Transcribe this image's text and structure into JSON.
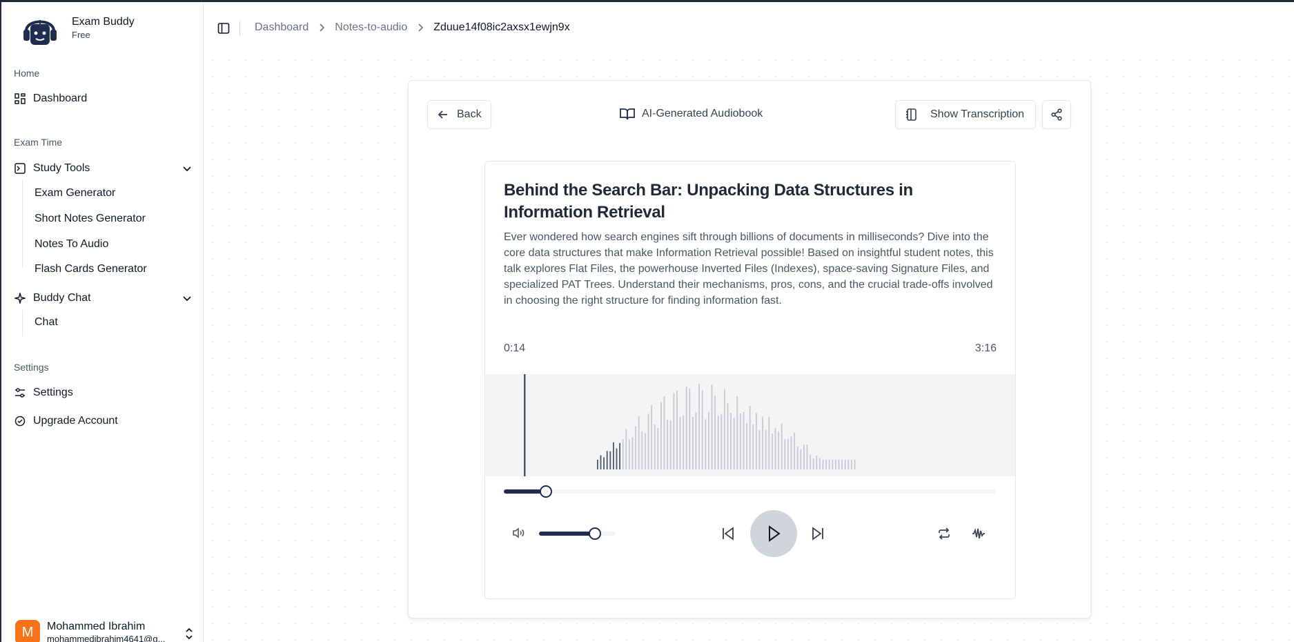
{
  "app": {
    "name": "Exam Buddy",
    "plan": "Free"
  },
  "sidebar": {
    "sections": [
      {
        "label": "Home"
      },
      {
        "label": "Exam Time"
      },
      {
        "label": "Settings"
      }
    ],
    "dashboard": "Dashboard",
    "study_tools": {
      "label": "Study Tools",
      "items": [
        "Exam Generator",
        "Short Notes Generator",
        "Notes To Audio",
        "Flash Cards Generator"
      ]
    },
    "buddy_chat": {
      "label": "Buddy Chat",
      "items": [
        "Chat"
      ]
    },
    "settings": "Settings",
    "upgrade": "Upgrade Account"
  },
  "user": {
    "initial": "M",
    "name": "Mohammed Ibrahim",
    "email": "mohammedibrahim4641@g..."
  },
  "breadcrumb": [
    "Dashboard",
    "Notes-to-audio",
    "Zduue14f08ic2axsx1ewjn9x"
  ],
  "player": {
    "back_label": "Back",
    "header_title": "AI-Generated Audiobook",
    "transcription_label": "Show Transcription",
    "title": "Behind the Search Bar: Unpacking Data Structures in Information Retrieval",
    "description": "Ever wondered how search engines sift through billions of documents in milliseconds? Dive into the core data structures that make Information Retrieval possible! Based on insightful student notes, this talk explores Flat Files, the powerhouse Inverted Files (Indexes), space-saving Signature Files, and specialized PAT Trees. Understand their mechanisms, pros, cons, and the crucial trade-offs involved in choosing the right structure for finding information fast.",
    "current_time": "0:14",
    "total_time": "3:16",
    "progress_fraction": 0.085,
    "volume_fraction": 0.74,
    "played_bars": 8
  },
  "colors": {
    "accent": "#1e2d4f",
    "avatar": "#f97316"
  }
}
